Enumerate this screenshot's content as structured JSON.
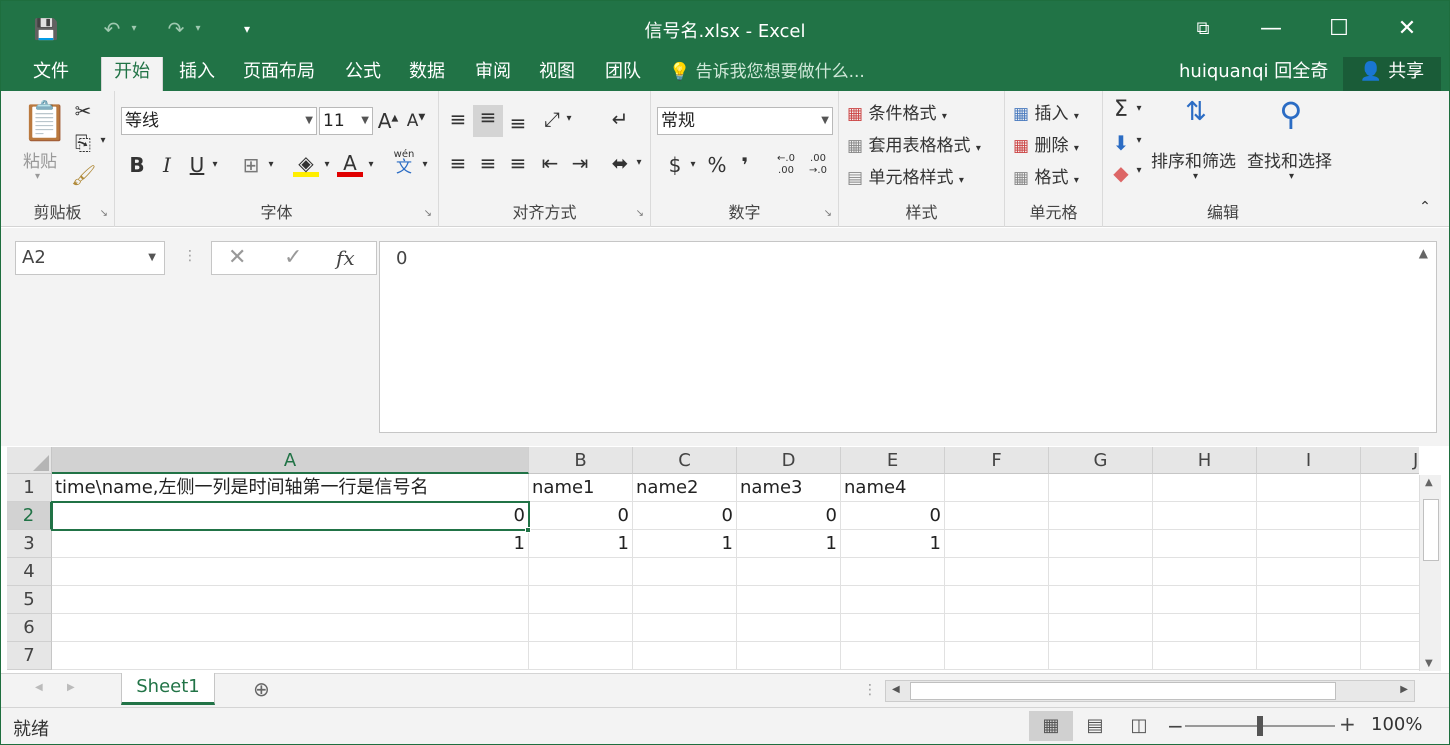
{
  "window": {
    "title": "信号名.xlsx - Excel"
  },
  "quick_access": {
    "save": "💾",
    "undo": "↶",
    "redo": "↷",
    "customize": "▾"
  },
  "window_buttons": {
    "restore_ribbon": "⧉",
    "minimize": "—",
    "maximize": "☐",
    "close": "✕"
  },
  "tabs": [
    {
      "label": "文件"
    },
    {
      "label": "开始"
    },
    {
      "label": "插入"
    },
    {
      "label": "页面布局"
    },
    {
      "label": "公式"
    },
    {
      "label": "数据"
    },
    {
      "label": "审阅"
    },
    {
      "label": "视图"
    },
    {
      "label": "团队"
    }
  ],
  "tell_me": "告诉我您想要做什么...",
  "user": "huiquanqi 回全奇",
  "share": "共享",
  "ribbon": {
    "clipboard": {
      "label": "剪贴板",
      "paste": "粘贴"
    },
    "font": {
      "label": "字体",
      "font_name": "等线",
      "font_size": "11",
      "bold": "B",
      "italic": "I",
      "underline": "U",
      "phonetic": "wén",
      "phonetic_sub": "文"
    },
    "alignment": {
      "label": "对齐方式"
    },
    "number": {
      "label": "数字",
      "format": "常规",
      "currency": "$",
      "percent": "%",
      "comma": "❜",
      "inc_decimal": "←.0 .00",
      "dec_decimal": ".00 →.0"
    },
    "styles": {
      "label": "样式",
      "conditional": "条件格式",
      "table": "套用表格格式",
      "cell_styles": "单元格样式"
    },
    "cells": {
      "label": "单元格",
      "insert": "插入",
      "delete": "删除",
      "format": "格式"
    },
    "editing": {
      "label": "编辑",
      "sort_filter": "排序和筛选",
      "find_select": "查找和选择",
      "sum": "Σ"
    }
  },
  "formula_bar": {
    "name_box": "A2",
    "cancel": "✕",
    "enter": "✓",
    "fx": "fx",
    "content": "0"
  },
  "columns": [
    "A",
    "B",
    "C",
    "D",
    "E",
    "F",
    "G",
    "H",
    "I",
    "J"
  ],
  "rows": [
    "1",
    "2",
    "3",
    "4",
    "5",
    "6",
    "7"
  ],
  "cells": {
    "A1": "time\\name,左侧一列是时间轴第一行是信号名",
    "B1": "name1",
    "C1": "name2",
    "D1": "name3",
    "E1": "name4",
    "A2": "0",
    "B2": "0",
    "C2": "0",
    "D2": "0",
    "E2": "0",
    "A3": "1",
    "B3": "1",
    "C3": "1",
    "D3": "1",
    "E3": "1"
  },
  "sheet_tab": "Sheet1",
  "add_sheet": "⊕",
  "status": {
    "ready": "就绪",
    "zoom": "100%",
    "zoom_out": "−",
    "zoom_in": "+"
  }
}
